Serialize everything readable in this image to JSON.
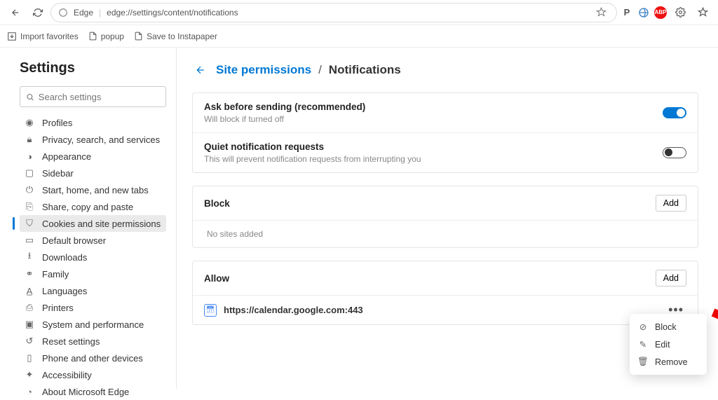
{
  "toolbar": {
    "edge_label": "Edge",
    "url": "edge://settings/content/notifications"
  },
  "favbar": {
    "import": "Import favorites",
    "popup": "popup",
    "save": "Save to Instapaper"
  },
  "side": {
    "title": "Settings",
    "search_placeholder": "Search settings",
    "items": [
      "Profiles",
      "Privacy, search, and services",
      "Appearance",
      "Sidebar",
      "Start, home, and new tabs",
      "Share, copy and paste",
      "Cookies and site permissions",
      "Default browser",
      "Downloads",
      "Family",
      "Languages",
      "Printers",
      "System and performance",
      "Reset settings",
      "Phone and other devices",
      "Accessibility",
      "About Microsoft Edge"
    ]
  },
  "crumb": {
    "parent": "Site permissions",
    "current": "Notifications"
  },
  "options": {
    "ask_title": "Ask before sending (recommended)",
    "ask_sub": "Will block if turned off",
    "quiet_title": "Quiet notification requests",
    "quiet_sub": "This will prevent notification requests from interrupting you"
  },
  "block": {
    "title": "Block",
    "add": "Add",
    "empty": "No sites added"
  },
  "allow": {
    "title": "Allow",
    "add": "Add",
    "site": "https://calendar.google.com:443"
  },
  "ctx": {
    "block": "Block",
    "edit": "Edit",
    "remove": "Remove"
  }
}
